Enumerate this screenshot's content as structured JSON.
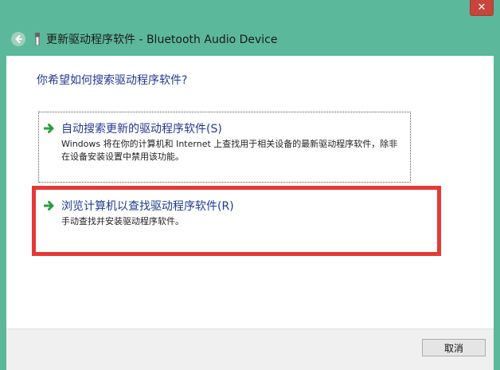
{
  "window": {
    "close_label": "✕",
    "title": "更新驱动程序软件 - Bluetooth Audio Device",
    "accent_color": "#5cb89a"
  },
  "content": {
    "question": "你希望如何搜索驱动程序软件?",
    "options": [
      {
        "title": "自动搜索更新的驱动程序软件(S)",
        "description": "Windows 将在你的计算机和 Internet 上查找用于相关设备的最新驱动程序软件，除非在设备安装设置中禁用该功能。",
        "icon": "green-arrow-icon"
      },
      {
        "title": "浏览计算机以查找驱动程序软件(R)",
        "description": "手动查找并安装驱动程序软件。",
        "icon": "green-arrow-icon",
        "highlight_color": "#e53935"
      }
    ]
  },
  "footer": {
    "cancel_label": "取消"
  }
}
